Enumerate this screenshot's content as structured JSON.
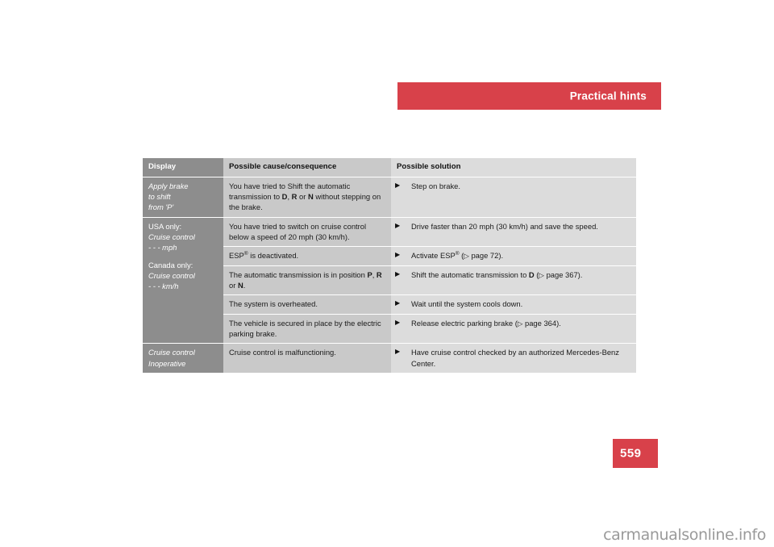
{
  "header": {
    "title": "Practical hints",
    "band_color": "#d8414a"
  },
  "page": {
    "number": "559",
    "number_block_color": "#d8414a"
  },
  "watermark": {
    "text": "carmanualsonline.info"
  },
  "table": {
    "columns": [
      {
        "key": "display",
        "label": "Display"
      },
      {
        "key": "cause",
        "label": "Possible cause/consequence"
      },
      {
        "key": "solution",
        "label": "Possible solution"
      }
    ],
    "colors": {
      "display_bg": "#8d8d8d",
      "display_fg": "#ffffff",
      "cause_bg": "#c9c9c9",
      "solution_bg": "#dcdcdc",
      "header_display_bg": "#8d8d8d",
      "header_cause_bg": "#c9c9c9",
      "header_solution_bg": "#dcdcdc"
    },
    "bullet_glyph": "▶",
    "reference_glyph": "▷",
    "groups": [
      {
        "display_lines": [
          {
            "text": "Apply brake",
            "italic": true
          },
          {
            "text": "to shift",
            "italic": true
          },
          {
            "text": "from 'P'",
            "italic": true
          }
        ],
        "rows": [
          {
            "cause_html": "You have tried to Shift the automatic trans-mission to <b>D</b>, <b>R</b> or <b>N</b> without stepping on the brake.",
            "cause_text": "You have tried to Shift the automatic transmission to D, R or N without stepping on the brake.",
            "solution_text": "Step on brake."
          }
        ]
      },
      {
        "display_lines": [
          {
            "text": "USA only:",
            "italic": false
          },
          {
            "text": "Cruise control",
            "italic": true
          },
          {
            "text": "- - - mph",
            "italic": true
          },
          {
            "text": "",
            "italic": false,
            "gap": true
          },
          {
            "text": "Canada only:",
            "italic": false
          },
          {
            "text": "Cruise control",
            "italic": true
          },
          {
            "text": "- - - km/h",
            "italic": true
          }
        ],
        "rows": [
          {
            "cause_text": "You have tried to switch on cruise control below a speed of 20 mph (30 km/h).",
            "solution_text": "Drive faster than 20 mph (30 km/h) and save the speed."
          },
          {
            "cause_text": "ESP® is deactivated.",
            "solution_text": "Activate ESP® (▷ page 72)."
          },
          {
            "cause_text": "The automatic transmission is in position P, R or N.",
            "solution_text": "Shift the automatic transmission to D (▷ page 367)."
          },
          {
            "cause_text": "The system is overheated.",
            "solution_text": "Wait until the system cools down."
          },
          {
            "cause_text": "The vehicle is secured in place by the electric parking brake.",
            "solution_text": "Release electric parking brake (▷ page 364)."
          }
        ]
      },
      {
        "display_lines": [
          {
            "text": "Cruise control",
            "italic": true
          },
          {
            "text": "Inoperative",
            "italic": true
          }
        ],
        "rows": [
          {
            "cause_text": "Cruise control is malfunctioning.",
            "solution_text": "Have cruise control checked by an authorized Mercedes-Benz Center."
          }
        ]
      }
    ]
  }
}
